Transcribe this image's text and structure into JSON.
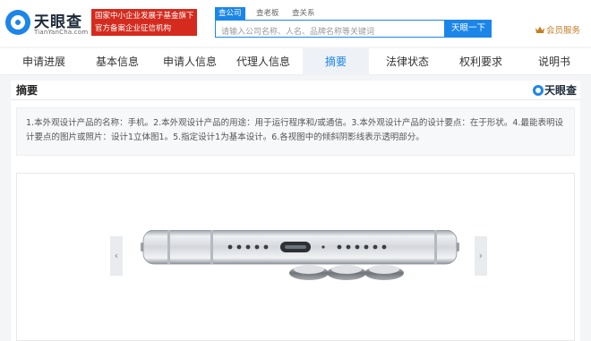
{
  "header": {
    "logo_name": "天眼查",
    "logo_domain": "TianYanCha.com",
    "badge_line1": "国家中小企业发展子基金旗下",
    "badge_line2": "官方备案企业征信机构",
    "search_tabs": [
      "查公司",
      "查老板",
      "查关系"
    ],
    "search_placeholder": "请输入公司名称、人名、品牌名称等关键词",
    "search_button": "天眼一下",
    "vip_label": "会员服务"
  },
  "tabs": [
    {
      "label": "申请进展",
      "active": false
    },
    {
      "label": "基本信息",
      "active": false
    },
    {
      "label": "申请人信息",
      "active": false
    },
    {
      "label": "代理人信息",
      "active": false
    },
    {
      "label": "摘要",
      "active": true
    },
    {
      "label": "法律状态",
      "active": false
    },
    {
      "label": "权利要求",
      "active": false
    },
    {
      "label": "说明书",
      "active": false
    }
  ],
  "content": {
    "section_title": "摘要",
    "brand": "天眼查",
    "abstract": "1.本外观设计产品的名称：手机。2.本外观设计产品的用途：用于运行程序和/或通信。3.本外观设计产品的设计要点：在于形状。4.最能表明设计要点的图片或照片：设计1立体图1。5.指定设计1为基本设计。6.各视图中的倾斜阴影线表示透明部分。",
    "prev_arrow": "‹",
    "next_arrow": "›"
  },
  "colors": {
    "brand_blue": "#1c86e8",
    "badge_red": "#d42b1e",
    "vip_gold": "#c47d24"
  }
}
